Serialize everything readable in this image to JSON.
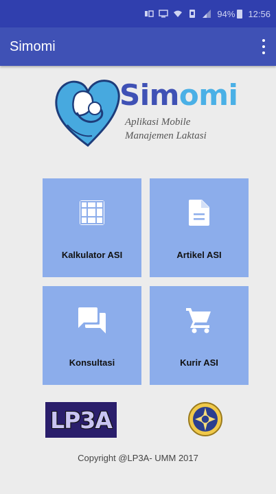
{
  "status_bar": {
    "battery": "94%",
    "time": "12:56"
  },
  "app_bar": {
    "title": "Simomi"
  },
  "logo": {
    "name_part1": "Sim",
    "name_part2": "omi",
    "tagline_line1": "Aplikasi Mobile",
    "tagline_line2": "Manajemen Laktasi"
  },
  "menu": {
    "tiles": [
      {
        "label": "Kalkulator ASI",
        "icon": "grid-icon"
      },
      {
        "label": "Artikel ASI",
        "icon": "document-icon"
      },
      {
        "label": "Konsultasi",
        "icon": "chat-icon"
      },
      {
        "label": "Kurir ASI",
        "icon": "cart-icon"
      }
    ]
  },
  "footer": {
    "lp3a_logo_text": "LP3A",
    "copyright": "Copyright @LP3A- UMM 2017"
  },
  "colors": {
    "status_bar": "#303fae",
    "app_bar": "#3f51b5",
    "tile": "#8cadeb",
    "background": "#ececec"
  }
}
